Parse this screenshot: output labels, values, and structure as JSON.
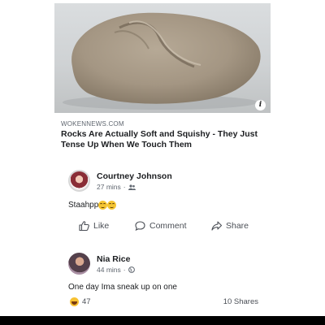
{
  "post": {
    "domain": "WOKENNEWS.COM",
    "headline": "Rocks Are Actually Soft and Squishy - They Just Tense Up When We Touch Them",
    "image_icon": "info-icon",
    "info_glyph": "i"
  },
  "comments": [
    {
      "name": "Courtney Johnson",
      "time": "27 mins",
      "audience_icon": "friends-icon",
      "text": "Staahpp",
      "emoji": [
        "smiling-emoji",
        "smiling-emoji"
      ]
    },
    {
      "name": "Nia Rice",
      "time": "44 mins",
      "audience_icon": "globe-icon",
      "text": "One day Ima sneak up on one"
    }
  ],
  "actions": {
    "like": "Like",
    "comment": "Comment",
    "share": "Share"
  },
  "footer": {
    "reaction_icon": "haha-reaction-icon",
    "reaction_count": "47",
    "shares": "10 Shares"
  },
  "colors": {
    "text": "#1c1e21",
    "secondary": "#606770",
    "action": "#4b4f56"
  }
}
